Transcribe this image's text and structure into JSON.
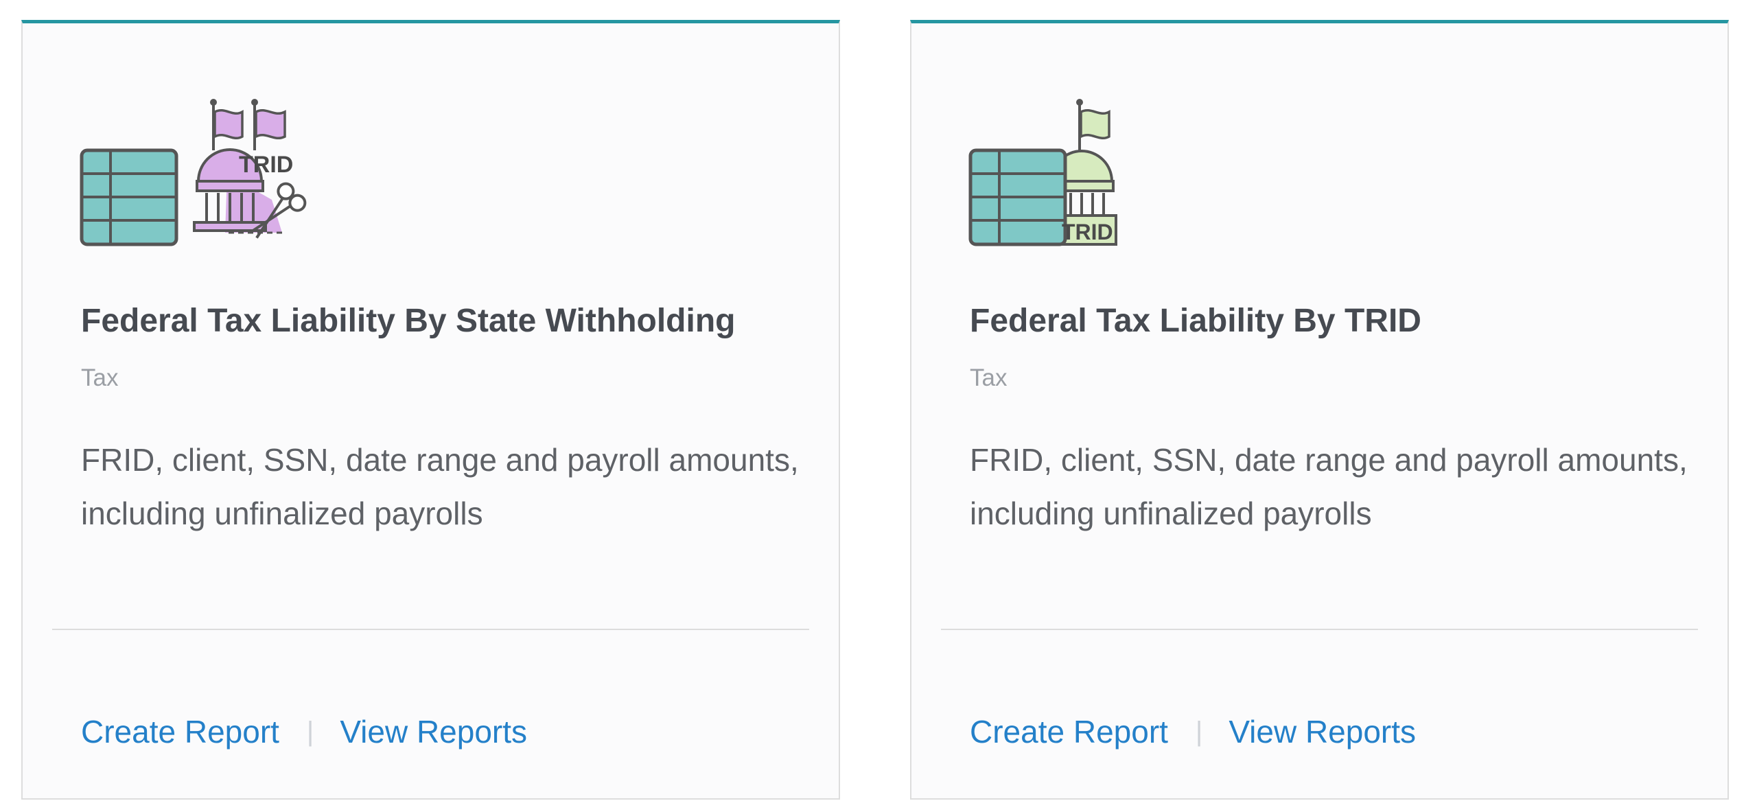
{
  "colors": {
    "accent": "#2596a1",
    "link": "#2480c9",
    "title": "#464a51",
    "muted": "#9a9ea4",
    "body_text": "#5e6166",
    "spreadsheet_fill": "#7fc8c6",
    "state_icon_fill": "#d9aee8",
    "federal_icon_fill": "#d7ebbf"
  },
  "cards": [
    {
      "icon": "spreadsheet-capitol-two-flags-scissors-icon",
      "icon_label": "TRID",
      "title": "Federal Tax Liability By State Withholding",
      "category": "Tax",
      "description": "FRID, client, SSN, date range and payroll amounts, including unfinalized payrolls",
      "create_label": "Create Report",
      "separator": "|",
      "view_label": "View Reports"
    },
    {
      "icon": "spreadsheet-capitol-flag-icon",
      "icon_label": "TRID",
      "title": "Federal Tax Liability By TRID",
      "category": "Tax",
      "description": "FRID, client, SSN, date range and payroll amounts, including unfinalized payrolls",
      "create_label": "Create Report",
      "separator": "|",
      "view_label": "View Reports"
    }
  ]
}
